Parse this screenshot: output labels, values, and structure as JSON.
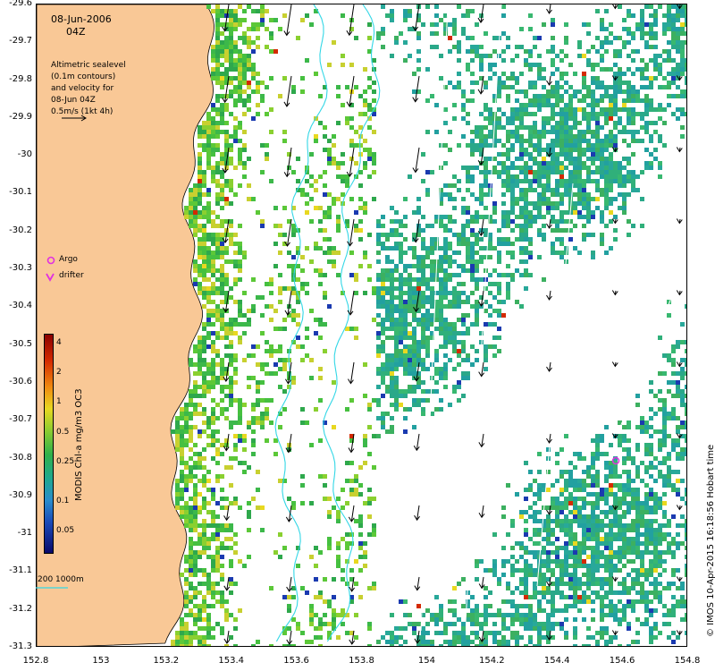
{
  "map": {
    "date_label": "08-Jun-2006",
    "time_label": "04Z",
    "legend_lines": [
      "Altimetric sealevel",
      "(0.1m contours)",
      "and velocity for",
      "08-Jun 04Z",
      "0.5m/s (1kt 4h)"
    ],
    "argo_label": "Argo",
    "drifter_label": "drifter",
    "depth_label": "200  1000m",
    "colorbar_title": "MODIS Chl-a mg/m3 OC3",
    "colorbar_ticks": [
      {
        "label": "4",
        "value": 4
      },
      {
        "label": "2",
        "value": 2
      },
      {
        "label": "1",
        "value": 1
      },
      {
        "label": "0.5",
        "value": 0.5
      },
      {
        "label": "0.25",
        "value": 0.25
      },
      {
        "label": "0.1",
        "value": 0.1
      },
      {
        "label": "0.05",
        "value": 0.05
      }
    ],
    "credit": "© IMOS 10-Apr-2015 16:18:56 Hobart time",
    "lat_ticks": [
      "-29.6",
      "-29.7",
      "-29.8",
      "-29.9",
      "-30",
      "-30.1",
      "-30.2",
      "-30.3",
      "-30.4",
      "-30.5",
      "-30.6",
      "-30.7",
      "-30.8",
      "-30.9",
      "-31",
      "-31.1",
      "-31.2",
      "-31.3"
    ],
    "lon_ticks": [
      "152.8",
      "153",
      "153.2",
      "153.4",
      "153.6",
      "153.8",
      "154",
      "154.2",
      "154.4",
      "154.6",
      "154.8"
    ],
    "lat_range": [
      -31.3,
      -29.6
    ],
    "lon_range": [
      152.8,
      154.8
    ],
    "colors": {
      "land": "#f9c896",
      "chl_low": "#1a9aa0",
      "chl_mid": "#3cb84a",
      "chl_high": "#c8d030",
      "contour": "#33d7e6",
      "argo": "#e030e0",
      "velocity_arrow": "#000000"
    }
  }
}
